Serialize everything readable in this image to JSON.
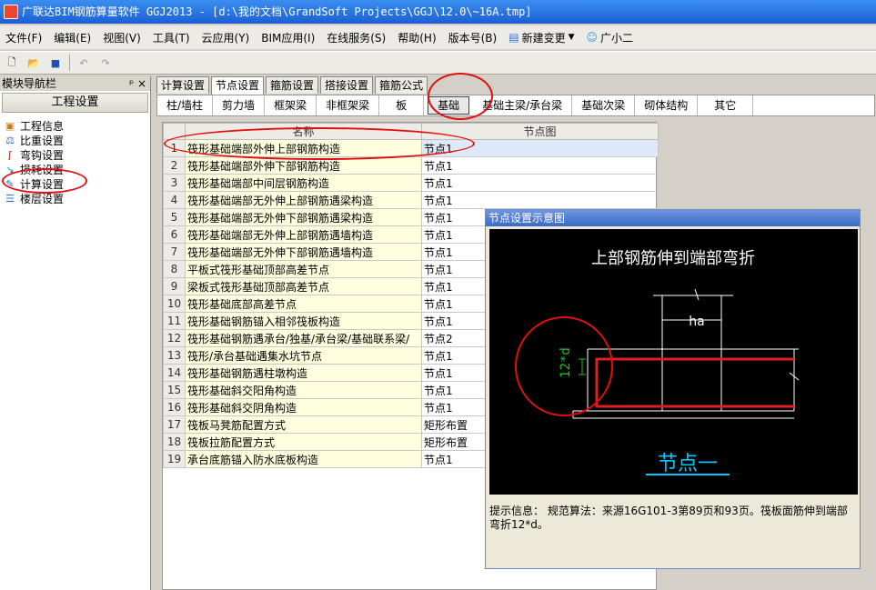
{
  "window": {
    "title": "广联达BIM钢筋算量软件 GGJ2013 - [d:\\我的文档\\GrandSoft Projects\\GGJ\\12.0\\~16A.tmp]"
  },
  "menu": [
    "文件(F)",
    "编辑(E)",
    "视图(V)",
    "工具(T)",
    "云应用(Y)",
    "BIM应用(I)",
    "在线服务(S)",
    "帮助(H)",
    "版本号(B)",
    "新建变更",
    "广小二"
  ],
  "left": {
    "panel_title": "模块导航栏",
    "pin": "ᵖ ×",
    "section": "工程设置",
    "items": [
      "工程信息",
      "比重设置",
      "弯钩设置",
      "损耗设置",
      "计算设置",
      "楼层设置"
    ]
  },
  "tabs": [
    "计算设置",
    "节点设置",
    "箍筋设置",
    "搭接设置",
    "箍筋公式"
  ],
  "subtabs": [
    "柱/墙柱",
    "剪力墙",
    "框架梁",
    "非框架梁",
    "板",
    "基础",
    "基础主梁/承台梁",
    "基础次梁",
    "砌体结构",
    "其它"
  ],
  "grid": {
    "headers": [
      "",
      "名称",
      "节点图"
    ],
    "rows": [
      [
        "1",
        "筏形基础端部外伸上部钢筋构造",
        "节点1"
      ],
      [
        "2",
        "筏形基础端部外伸下部钢筋构造",
        "节点1"
      ],
      [
        "3",
        "筏形基础端部中间层钢筋构造",
        "节点1"
      ],
      [
        "4",
        "筏形基础端部无外伸上部钢筋遇梁构造",
        "节点1"
      ],
      [
        "5",
        "筏形基础端部无外伸下部钢筋遇梁构造",
        "节点1"
      ],
      [
        "6",
        "筏形基础端部无外伸上部钢筋遇墙构造",
        "节点1"
      ],
      [
        "7",
        "筏形基础端部无外伸下部钢筋遇墙构造",
        "节点1"
      ],
      [
        "8",
        "平板式筏形基础顶部高差节点",
        "节点1"
      ],
      [
        "9",
        "梁板式筏形基础顶部高差节点",
        "节点1"
      ],
      [
        "10",
        "筏形基础底部高差节点",
        "节点1"
      ],
      [
        "11",
        "筏形基础钢筋锚入相邻筏板构造",
        "节点1"
      ],
      [
        "12",
        "筏形基础钢筋遇承台/独基/承台梁/基础联系梁/",
        "节点2"
      ],
      [
        "13",
        "筏形/承台基础遇集水坑节点",
        "节点1"
      ],
      [
        "14",
        "筏形基础钢筋遇柱墩构造",
        "节点1"
      ],
      [
        "15",
        "筏形基础斜交阳角构造",
        "节点1"
      ],
      [
        "16",
        "筏形基础斜交阴角构造",
        "节点1"
      ],
      [
        "17",
        "筏板马凳筋配置方式",
        "矩形布置"
      ],
      [
        "18",
        "筏板拉筋配置方式",
        "矩形布置"
      ],
      [
        "19",
        "承台底筋锚入防水底板构造",
        "节点1"
      ]
    ]
  },
  "popup": {
    "title": "节点设置示意图",
    "diagram_title": "上部钢筋伸到端部弯折",
    "ha_label": "ha",
    "dim_label": "12*d",
    "node_label": "节点一",
    "hint_label": "提示信息：",
    "hint_text": "规范算法：来源16G101-3第89页和93页。筏板面筋伸到端部弯折12*d。"
  },
  "colors": {
    "rebar": "#e02020",
    "dim": "#20c020",
    "node": "#00c8ff"
  }
}
